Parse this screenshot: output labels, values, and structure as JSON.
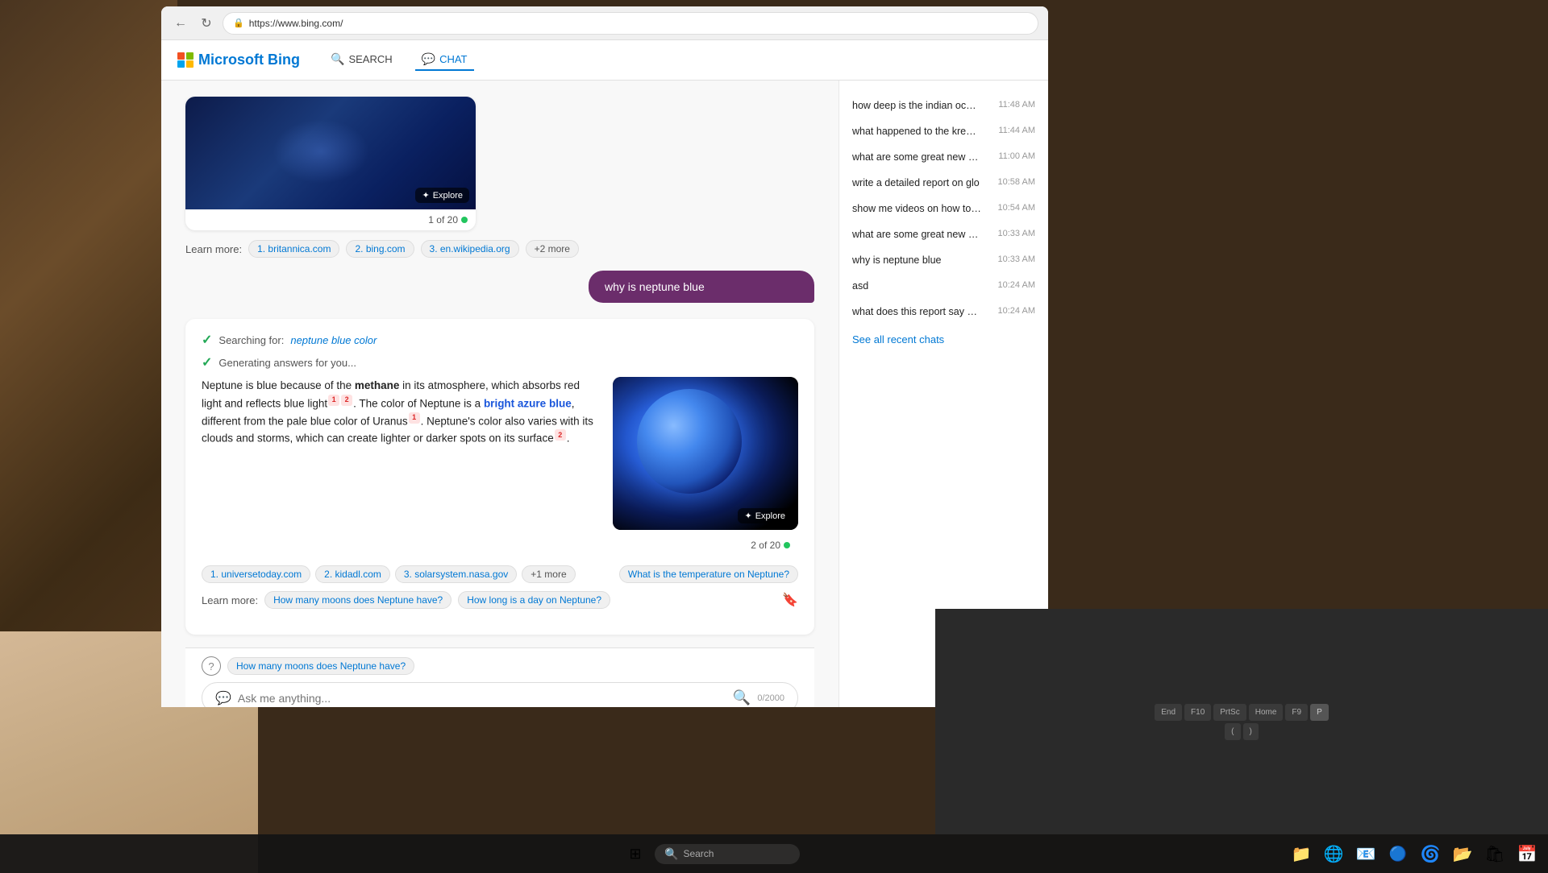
{
  "browser": {
    "url": "https://www.bing.com/",
    "back_btn": "←",
    "refresh_btn": "↻"
  },
  "bing": {
    "logo": "Microsoft Bing",
    "nav_search": "SEARCH",
    "nav_chat": "CHAT"
  },
  "first_message": {
    "user_query": "why is neptune blue",
    "image_explore": "Explore",
    "of_count": "1 of 20",
    "learn_more_label": "Learn more:",
    "sources": [
      "1. britannica.com",
      "2. bing.com",
      "3. en.wikipedia.org",
      "+2 more"
    ]
  },
  "second_message": {
    "search_status_1": "Searching for:",
    "search_term": "neptune blue color",
    "search_status_2": "Generating answers for you...",
    "response_text_parts": {
      "intro": "Neptune is blue because of the ",
      "bold1": "methane",
      "mid": " in its atmosphere, which absorbs red light and reflects blue light",
      "after_refs": ". The color of Neptune is a ",
      "highlight": "bright azure blue",
      "mid2": ", different from the pale blue color of Uranus",
      "end": ". Neptune's color also varies with its clouds and storms, which can create lighter or darker spots on its surface",
      "period": "."
    },
    "of_count": "2 of 20",
    "explore_btn": "Explore",
    "learn_more_label": "Learn more:",
    "sources": [
      "1. universetoday.com",
      "2. kidadl.com",
      "3. solarsystem.nasa.gov",
      "+1 more"
    ],
    "suggestions": [
      "What is the temperature on Neptune?",
      "How many moons does Neptune have?",
      "How long is a day on Neptune?"
    ]
  },
  "input_area": {
    "suggestion_chip": "How many moons does Neptune have?",
    "placeholder": "Ask me anything...",
    "char_count": "0/2000"
  },
  "recent_chats": {
    "items": [
      {
        "query": "how deep is the indian ocean",
        "time": "11:48 AM"
      },
      {
        "query": "what happened to the kremlin t",
        "time": "11:44 AM"
      },
      {
        "query": "what are some great new restau",
        "time": "11:00 AM"
      },
      {
        "query": "write a detailed report on glo",
        "time": "10:58 AM"
      },
      {
        "query": "show me videos on how to tie a",
        "time": "10:54 AM"
      },
      {
        "query": "what are some great new restau",
        "time": "10:33 AM"
      },
      {
        "query": "why is neptune blue",
        "time": "10:33 AM"
      },
      {
        "query": "asd",
        "time": "10:24 AM"
      },
      {
        "query": "what does this report say abou",
        "time": "10:24 AM"
      }
    ],
    "see_all": "See all recent chats"
  },
  "taskbar": {
    "search_placeholder": "Search",
    "icons": [
      "📁",
      "🌐",
      "📧",
      "🔵",
      "💚",
      "📅",
      "🟦"
    ]
  }
}
